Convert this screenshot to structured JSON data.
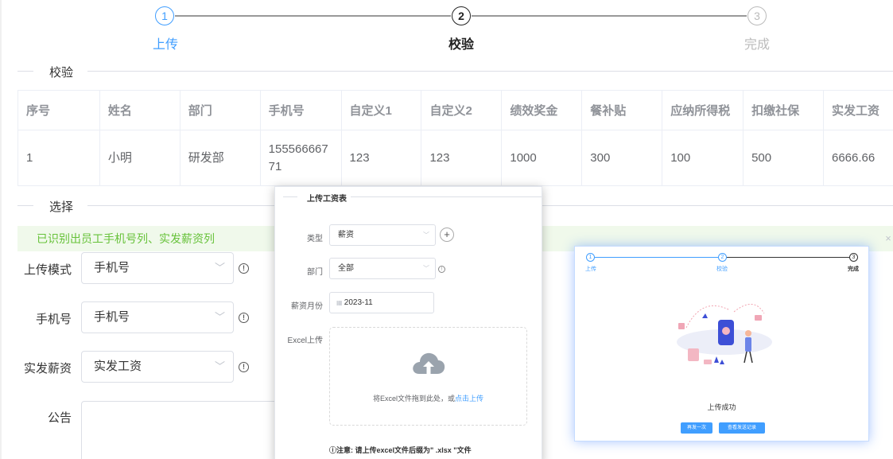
{
  "steps": [
    {
      "num": "1",
      "label": "上传"
    },
    {
      "num": "2",
      "label": "校验"
    },
    {
      "num": "3",
      "label": "完成"
    }
  ],
  "sections": {
    "verify": "校验",
    "select": "选择"
  },
  "table": {
    "headers": [
      "序号",
      "姓名",
      "部门",
      "手机号",
      "自定义1",
      "自定义2",
      "绩效奖金",
      "餐补贴",
      "应纳所得税",
      "扣缴社保",
      "实发工资"
    ],
    "rows": [
      [
        "1",
        "小明",
        "研发部",
        "15556666771",
        "123",
        "123",
        "1000",
        "300",
        "100",
        "500",
        "6666.66"
      ]
    ]
  },
  "alert": {
    "text": "已识别出员工手机号列、实发薪资列",
    "close": "×"
  },
  "form": {
    "upload_mode": {
      "label": "上传模式",
      "value": "手机号"
    },
    "phone": {
      "label": "手机号",
      "value": "手机号"
    },
    "salary": {
      "label": "实发薪资",
      "value": "实发工资"
    },
    "notice": {
      "label": "公告"
    }
  },
  "upload_dialog": {
    "title": "上传工资表",
    "type_label": "类型",
    "type_value": "薪资",
    "dept_label": "部门",
    "dept_value": "全部",
    "month_label": "薪资月份",
    "month_value": "2023-11",
    "excel_label": "Excel上传",
    "drop_text": "将Excel文件拖到此处，或",
    "drop_link": "点击上传",
    "note": "ⓘ注意: 请上传excel文件后缀为\" .xlsx \"文件"
  },
  "success_card": {
    "steps": [
      {
        "num": "1",
        "label": "上传"
      },
      {
        "num": "2",
        "label": "校验"
      },
      {
        "num": "3",
        "label": "完成"
      }
    ],
    "message": "上传成功",
    "btn_again": "再发一次",
    "btn_view": "查看发送记录"
  },
  "colors": {
    "accent": "#409eff",
    "success_bg": "#f0f9eb",
    "success_text": "#67c23a"
  }
}
